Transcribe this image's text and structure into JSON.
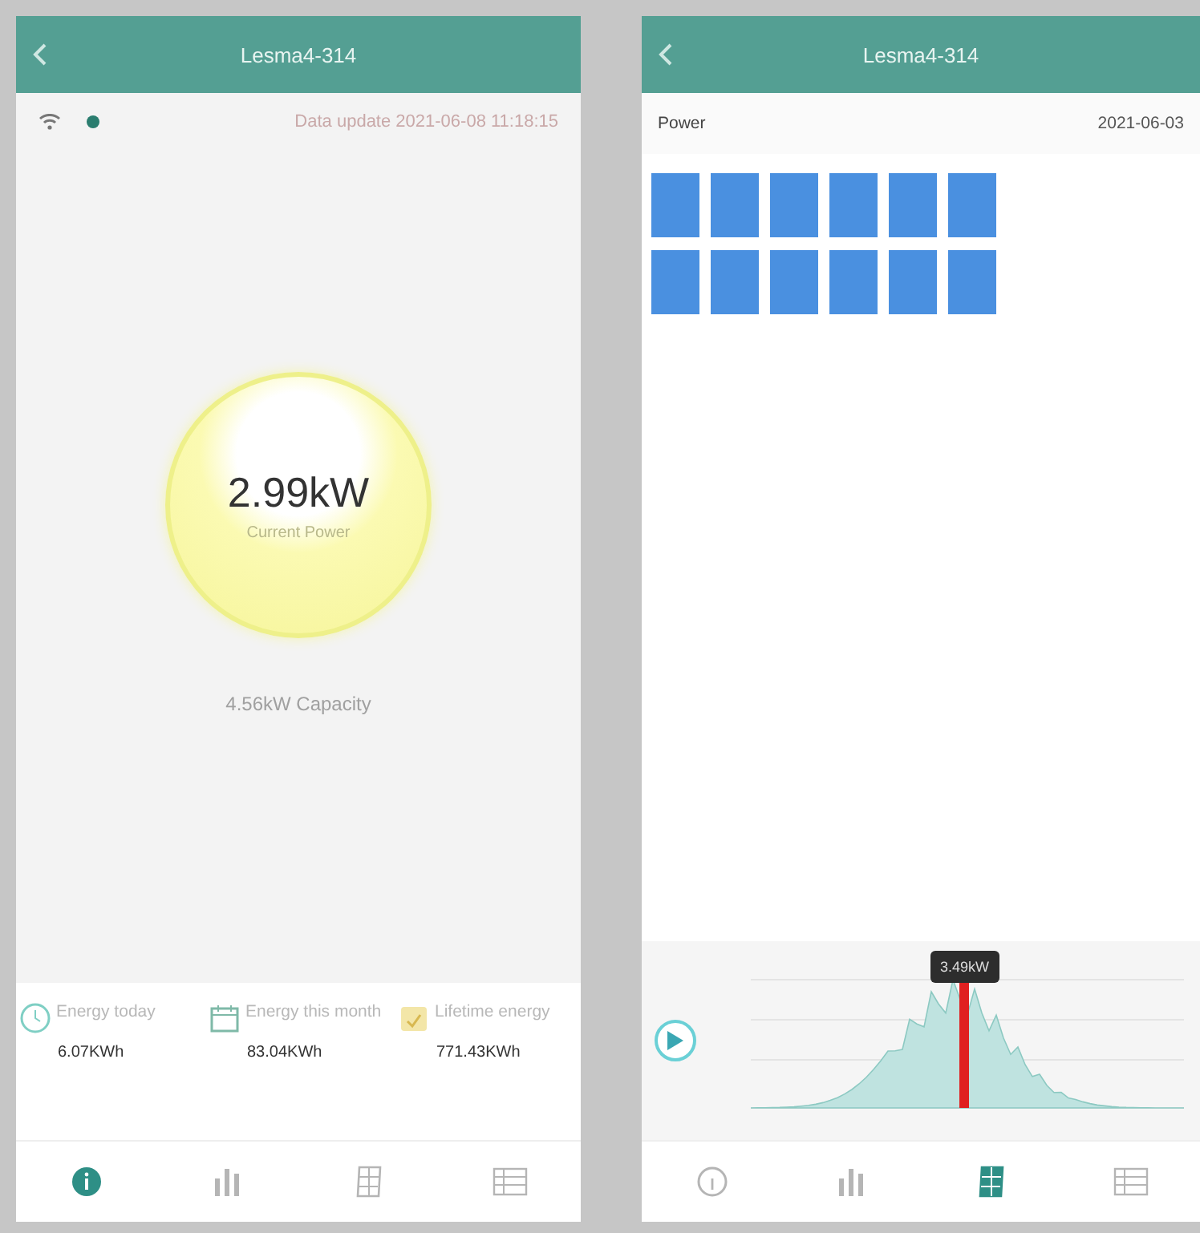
{
  "screens": [
    {
      "kind": "overview",
      "title": "Lesma4-314",
      "status": {
        "update": "Data update 2021-06-08 11:18:15"
      },
      "gauge": {
        "value": "2.99kW",
        "label": "Current Power"
      },
      "capacity": "4.56kW Capacity",
      "stats": [
        {
          "kind": "today",
          "label": "Energy today",
          "value": "6.07KWh"
        },
        {
          "kind": "month",
          "label": "Energy this month",
          "value": "83.04KWh"
        },
        {
          "kind": "lifetime",
          "label": "Lifetime energy",
          "value": "771.43KWh"
        }
      ],
      "tabs": [
        {
          "kind": "info",
          "selected": true
        },
        {
          "kind": "chart",
          "selected": false
        },
        {
          "kind": "panels",
          "selected": false
        },
        {
          "kind": "list",
          "selected": false
        }
      ]
    },
    {
      "kind": "layout",
      "title": "Lesma4-314",
      "toolbar": {
        "metric": "Power",
        "date": "2021-06-03"
      },
      "tooltip": "3.49kW",
      "tabs": [
        {
          "kind": "info",
          "selected": false
        },
        {
          "kind": "chart",
          "selected": false
        },
        {
          "kind": "panels",
          "selected": true
        },
        {
          "kind": "list",
          "selected": false
        }
      ]
    }
  ]
}
